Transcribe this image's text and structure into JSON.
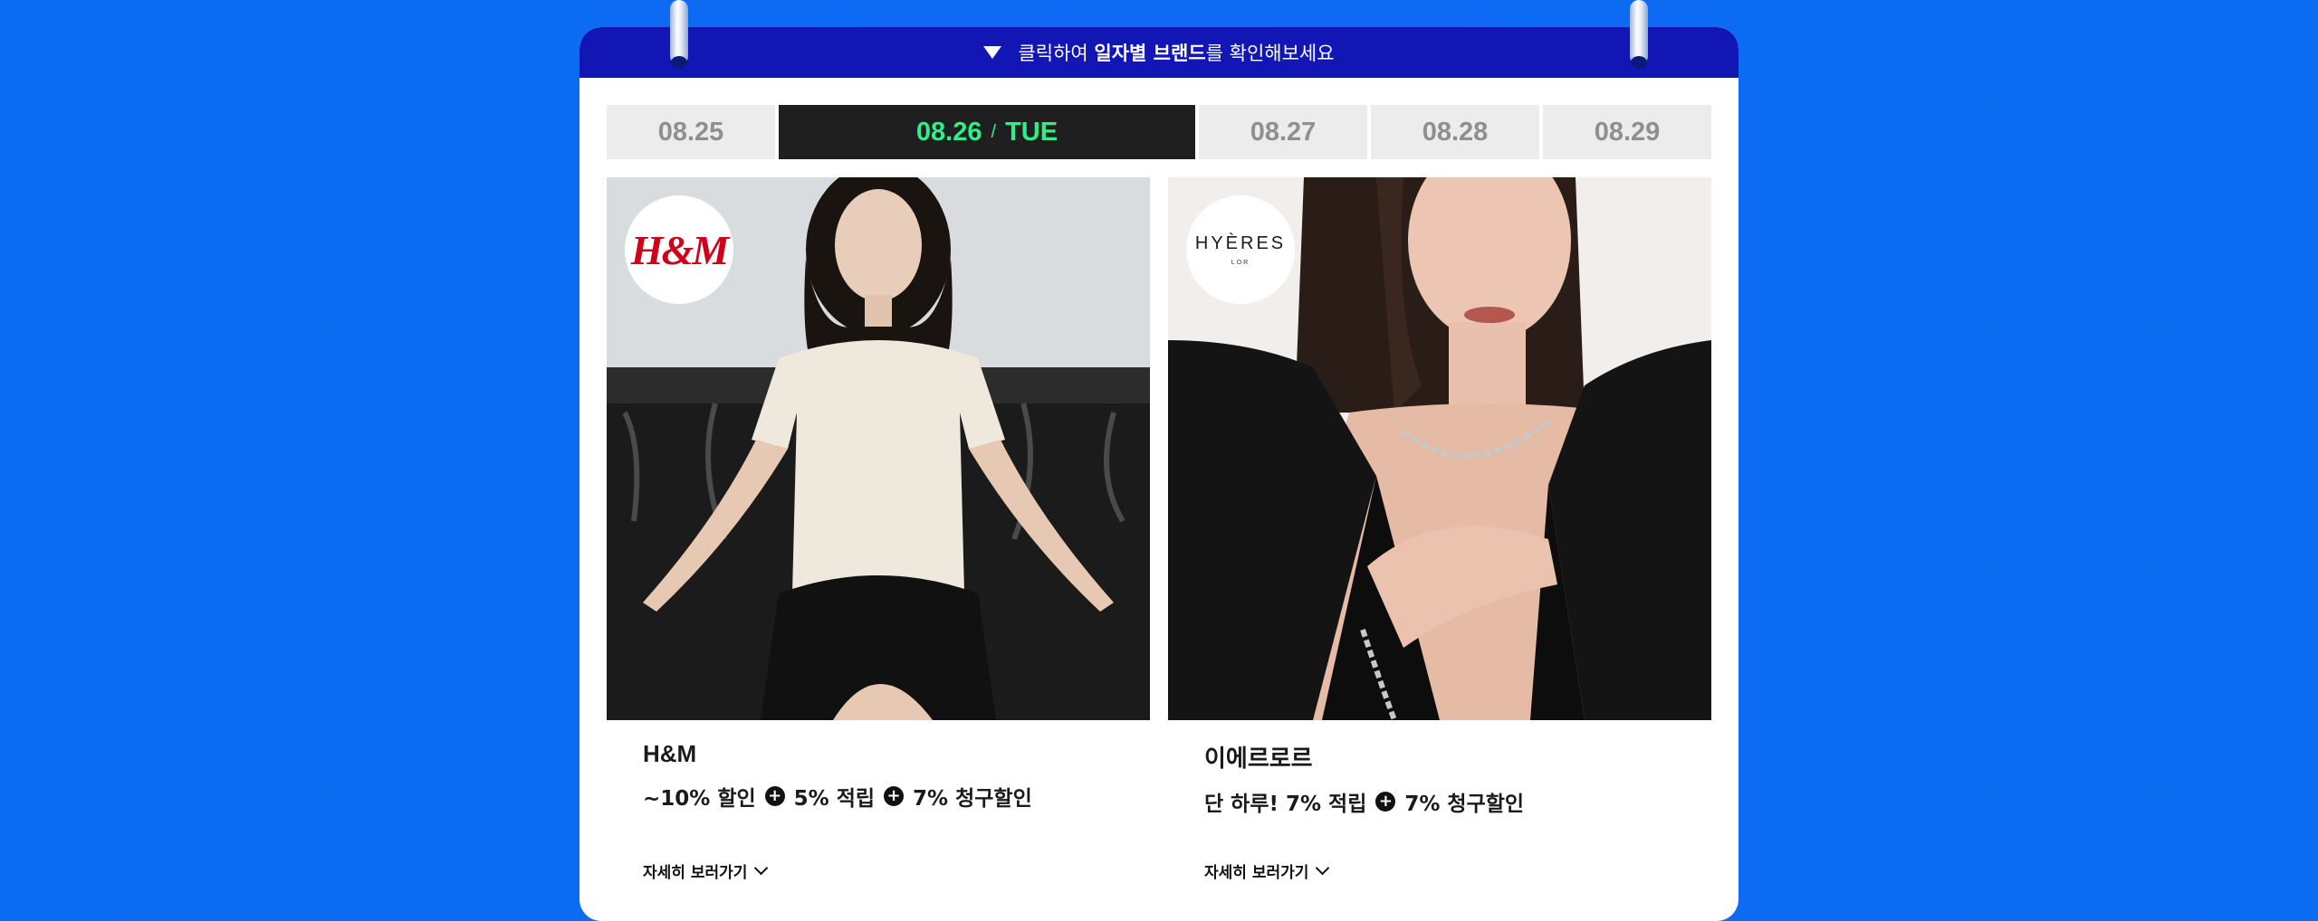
{
  "header": {
    "prefix": "클릭하여 ",
    "bold": "일자별 브랜드",
    "suffix": "를 확인해보세요"
  },
  "dates": {
    "d1": "08.25",
    "active_date": "08.26",
    "active_sep": "/",
    "active_day": "TUE",
    "d3": "08.27",
    "d4": "08.28",
    "d5": "08.29"
  },
  "cards": [
    {
      "logo_text": "H&M",
      "name": "H&M",
      "benefit_parts": [
        "~10% 할인",
        "5% 적립",
        "7% 청구할인"
      ],
      "detail_label": "자세히 보러가기"
    },
    {
      "logo_text": "HYÈRES",
      "logo_sub": "LOR",
      "name": "이에르로르",
      "benefit_parts": [
        "단 하루! 7% 적립",
        "7% 청구할인"
      ],
      "detail_label": "자세히 보러가기"
    }
  ],
  "colors": {
    "background": "#0a6cf2",
    "header_bar": "#1116b5",
    "active_tab_bg": "#1f1f1f",
    "active_tab_text": "#2df08a",
    "inactive_tab_bg": "#ececec",
    "inactive_tab_text": "#8f8f8f",
    "hm_red": "#d0021b"
  }
}
